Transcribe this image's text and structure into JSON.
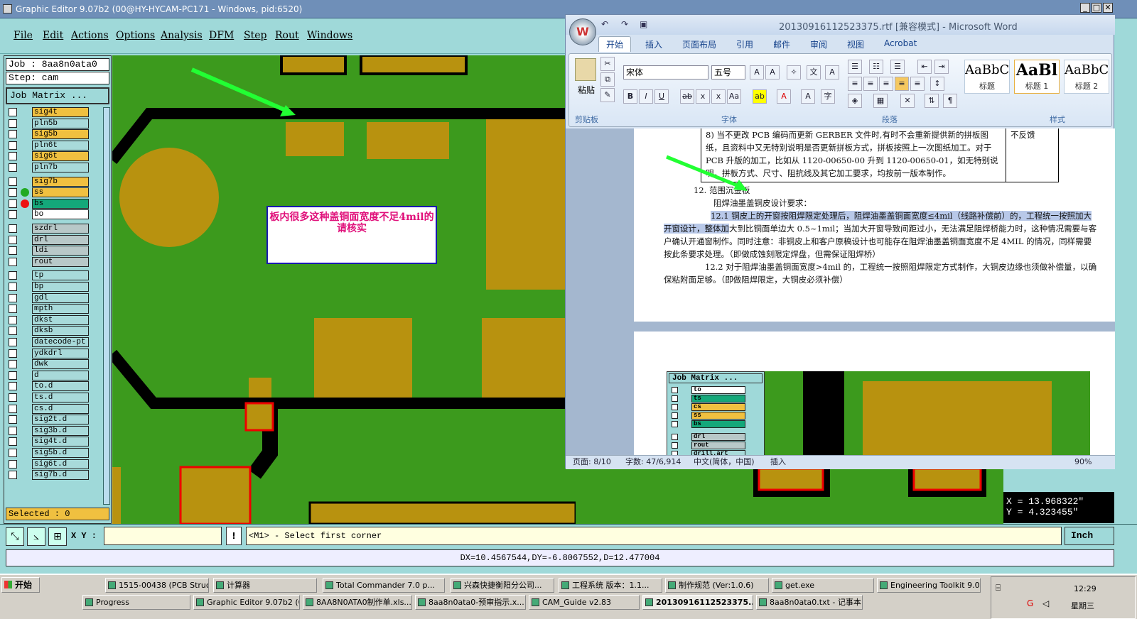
{
  "ge": {
    "title": "Graphic Editor 9.07b2 (00@HY-HYCAM-PC171 - Windows, pid:6520)",
    "menu": [
      "File",
      "Edit",
      "Actions",
      "Options",
      "Analysis",
      "DFM",
      "Step",
      "Rout",
      "Windows"
    ],
    "job": "Job : 8aa8n0ata0",
    "step": "Step: cam",
    "job_matrix": "Job Matrix ...",
    "layers": [
      {
        "name": "sig4t",
        "color": "#f0c040"
      },
      {
        "name": "pln5b",
        "color": "#a8dada"
      },
      {
        "name": "sig5b",
        "color": "#f0c040"
      },
      {
        "name": "pln6t",
        "color": "#a8dada"
      },
      {
        "name": "sig6t",
        "color": "#f0c040"
      },
      {
        "name": "pln7b",
        "color": "#a8dada"
      },
      {
        "name": "sig7b",
        "color": "#f0c040"
      },
      {
        "name": "ss",
        "color": "#f0c040"
      },
      {
        "name": "bs",
        "color": "#14a87a"
      },
      {
        "name": "bo",
        "color": "#ffffff"
      },
      {
        "name": "szdrl",
        "color": "#b8c8c8"
      },
      {
        "name": "drl",
        "color": "#b8c8c8"
      },
      {
        "name": "ldi",
        "color": "#b8c8c8"
      },
      {
        "name": "rout",
        "color": "#b8c8c8"
      },
      {
        "name": "tp",
        "color": "#a8dada"
      },
      {
        "name": "bp",
        "color": "#a8dada"
      },
      {
        "name": "gdl",
        "color": "#a8dada"
      },
      {
        "name": "mpth",
        "color": "#a8dada"
      },
      {
        "name": "dkst",
        "color": "#a8dada"
      },
      {
        "name": "dksb",
        "color": "#a8dada"
      },
      {
        "name": "datecode-pt",
        "color": "#a8dada"
      },
      {
        "name": "ydkdrl",
        "color": "#a8dada"
      },
      {
        "name": "dwk",
        "color": "#a8dada"
      },
      {
        "name": "d",
        "color": "#a8dada"
      },
      {
        "name": "to.d",
        "color": "#a8dada"
      },
      {
        "name": "ts.d",
        "color": "#a8dada"
      },
      {
        "name": "cs.d",
        "color": "#a8dada"
      },
      {
        "name": "sig2t.d",
        "color": "#a8dada"
      },
      {
        "name": "sig3b.d",
        "color": "#a8dada"
      },
      {
        "name": "sig4t.d",
        "color": "#a8dada"
      },
      {
        "name": "sig5b.d",
        "color": "#a8dada"
      },
      {
        "name": "sig6t.d",
        "color": "#a8dada"
      },
      {
        "name": "sig7b.d",
        "color": "#a8dada"
      }
    ],
    "selected": "Selected : 0",
    "annotation": "板内很多这种盖铜面宽度不足4mil的  请核实",
    "coord_x": "X = 13.968322\"",
    "coord_y": "Y = 4.323455\"",
    "xy_label": "X Y :",
    "prompt": "<M1> - Select first corner",
    "units": "Inch",
    "measure": "DX=10.4567544,DY=-6.8067552,D=12.477004"
  },
  "word": {
    "title": "20130916112523375.rtf [兼容模式] - Microsoft Word",
    "office_label": "W",
    "tabs": [
      "开始",
      "插入",
      "页面布局",
      "引用",
      "邮件",
      "审阅",
      "视图",
      "Acrobat"
    ],
    "font_name": "宋体",
    "font_size": "五号",
    "group_clipboard": "剪贴板",
    "paste": "粘贴",
    "group_font": "字体",
    "group_paragraph": "段落",
    "group_styles": "样式",
    "styles": [
      {
        "sample": "AaBbC",
        "label": "标题"
      },
      {
        "sample": "AaBl",
        "label": "标题 1"
      },
      {
        "sample": "AaBbC",
        "label": "标题 2"
      }
    ],
    "doc": {
      "table_text": "8) 当不更改 PCB 编码而更新 GERBER 文件时,有时不会重新提供新的拼板图纸，且资料中又无特别说明是否更新拼板方式，拼板按照上一次图纸加工。对于 PCB 升版的加工，比如从 1120-00650-00 升到 1120-00650-01，如无特别说明，拼板方式、尺寸、阻抗线及其它加工要求，均按前一版本制作。",
      "table_right": "不反馈",
      "h12": "12.  范围沉金板",
      "sub": "阻焊油墨盖铜皮设计要求：",
      "p121_highlight": "12.1 铜皮上的开窗按阻焊限定处理后，阻焊油墨盖铜面宽度≤4mil（线路补偿前）的，工程统一按照加大开窗设计，整体加",
      "p121_rest": "大到比铜面单边大 0.5~1mil；当加大开窗导致间距过小，无法满足阻焊桥能力时，这种情况需要与客户确认开通窗制作。同时注意：非铜皮上和客户原稿设计也可能存在阻焊油墨盖铜面宽度不足 4MIL 的情况，同样需要按此条要求处理。（即做成蚀刻限定焊盘，但需保证阻焊桥）",
      "p122": "12.2 对于阻焊油墨盖铜面宽度>4mil 的，工程统一按照阻焊限定方式制作，大铜皮边缘也须做补偿量，以确保粘附面足够。（即做阻焊限定，大铜皮必须补偿）",
      "embedded_job_matrix": "Job Matrix ...",
      "embedded_layers": [
        "to",
        "ts",
        "cs",
        "ss",
        "bs",
        "drl",
        "rout",
        "drill.art"
      ]
    },
    "status": {
      "page": "页面: 8/10",
      "words": "字数: 47/6,914",
      "lang": "中文(简体，中国)",
      "mode": "插入",
      "zoom": "90%"
    }
  },
  "taskbar": {
    "start": "开始",
    "row1": [
      "1515-00438 (PCB Struc...",
      "计算器",
      "Total Commander 7.0 p...",
      "兴森快捷衡阳分公司...",
      "工程系统  版本：1.1...",
      "制作规范 (Ver:1.0.6)",
      "get.exe",
      "Engineering Toolkit 9.0..."
    ],
    "row2": [
      "Progress",
      "Graphic Editor 9.07b2 (0...",
      "8AA8N0ATA0制作单.xls...",
      "8aa8n0ata0-预审指示.x...",
      "CAM_Guide v2.83",
      "20130916112523375....",
      "8aa8n0ata0.txt - 记事本"
    ],
    "time": "12:29",
    "day": "星期三"
  }
}
